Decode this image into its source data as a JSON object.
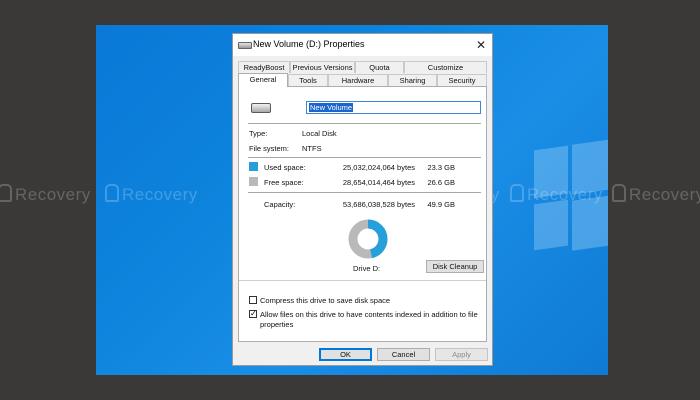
{
  "window": {
    "title": "New Volume (D:) Properties",
    "icon": "drive-icon",
    "close_glyph": "✕"
  },
  "watermark": {
    "text": "Recovery"
  },
  "tabs": {
    "row1": [
      "ReadyBoost",
      "Previous Versions",
      "Quota",
      "Customize"
    ],
    "row2": [
      "General",
      "Tools",
      "Hardware",
      "Sharing",
      "Security"
    ],
    "active": "General"
  },
  "general": {
    "volume_name": "New Volume",
    "type_label": "Type:",
    "type_value": "Local Disk",
    "fs_label": "File system:",
    "fs_value": "NTFS",
    "used": {
      "label": "Used space:",
      "bytes": "25,032,024,064 bytes",
      "size": "23.3 GB",
      "color": "#26a0da"
    },
    "free": {
      "label": "Free space:",
      "bytes": "28,654,014,464 bytes",
      "size": "26.6 GB",
      "color": "#b9b9b9"
    },
    "capacity": {
      "label": "Capacity:",
      "bytes": "53,686,038,528 bytes",
      "size": "49.9 GB"
    },
    "drive_label": "Drive D:",
    "cleanup_button": "Disk Cleanup",
    "used_fraction": 0.466
  },
  "options": {
    "compress": {
      "label": "Compress this drive to save disk space",
      "checked": false
    },
    "index_line1": "Allow files on this drive to have contents indexed in addition to file",
    "index_line2": "properties",
    "index_checked": true,
    "check_glyph": "✓"
  },
  "buttons": {
    "ok": "OK",
    "cancel": "Cancel",
    "apply": "Apply"
  }
}
